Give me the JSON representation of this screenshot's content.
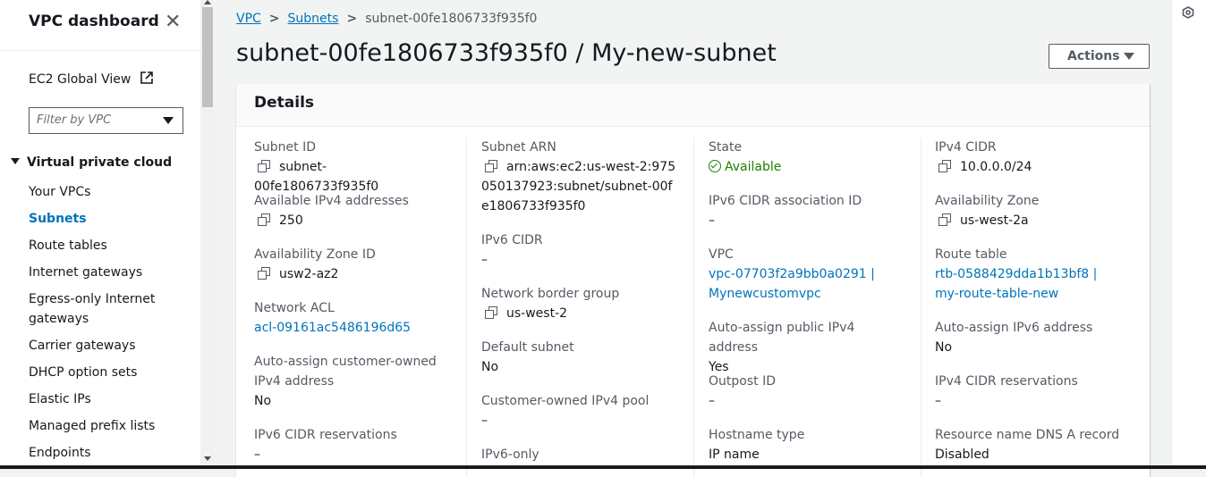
{
  "sidebar": {
    "title": "VPC dashboard",
    "global_view": "EC2 Global View",
    "filter_placeholder": "Filter by VPC",
    "section": "Virtual private cloud",
    "items": [
      {
        "label": "Your VPCs"
      },
      {
        "label": "Subnets"
      },
      {
        "label": "Route tables"
      },
      {
        "label": "Internet gateways"
      },
      {
        "label": "Egress-only Internet gateways"
      },
      {
        "label": "Carrier gateways"
      },
      {
        "label": "DHCP option sets"
      },
      {
        "label": "Elastic IPs"
      },
      {
        "label": "Managed prefix lists"
      },
      {
        "label": "Endpoints"
      }
    ]
  },
  "breadcrumb": {
    "vpc": "VPC",
    "subnets": "Subnets",
    "current": "subnet-00fe1806733f935f0"
  },
  "header": {
    "title": "subnet-00fe1806733f935f0 / My-new-subnet",
    "actions_label": "Actions"
  },
  "details": {
    "heading": "Details",
    "col1": {
      "subnet_id_label": "Subnet ID",
      "subnet_id": "subnet-00fe1806733f935f0",
      "avail_ipv4_label": "Available IPv4 addresses",
      "avail_ipv4": "250",
      "az_id_label": "Availability Zone ID",
      "az_id": "usw2-az2",
      "nacl_label": "Network ACL",
      "nacl": "acl-09161ac5486196d65",
      "auto_cust_label": "Auto-assign customer-owned IPv4 address",
      "auto_cust": "No",
      "ipv6_res_label": "IPv6 CIDR reservations",
      "ipv6_res": "–"
    },
    "col2": {
      "arn_label": "Subnet ARN",
      "arn": "arn:aws:ec2:us-west-2:975050137923:subnet/subnet-00fe1806733f935f0",
      "ipv6_cidr_label": "IPv6 CIDR",
      "ipv6_cidr": "–",
      "nbg_label": "Network border group",
      "nbg": "us-west-2",
      "default_label": "Default subnet",
      "default": "No",
      "cust_pool_label": "Customer-owned IPv4 pool",
      "cust_pool": "–",
      "ipv6_only_label": "IPv6-only"
    },
    "col3": {
      "state_label": "State",
      "state": "Available",
      "ipv6_assoc_label": "IPv6 CIDR association ID",
      "ipv6_assoc": "–",
      "vpc_label": "VPC",
      "vpc": "vpc-07703f2a9bb0a0291 | Mynewcustomvpc",
      "auto_pub_label": "Auto-assign public IPv4 address",
      "auto_pub": "Yes",
      "outpost_label": "Outpost ID",
      "outpost": "–",
      "hostname_label": "Hostname type",
      "hostname": "IP name"
    },
    "col4": {
      "ipv4_cidr_label": "IPv4 CIDR",
      "ipv4_cidr": "10.0.0.0/24",
      "az_label": "Availability Zone",
      "az": "us-west-2a",
      "rt_label": "Route table",
      "rt": "rtb-0588429dda1b13bf8 | my-route-table-new",
      "auto_ipv6_label": "Auto-assign IPv6 address",
      "auto_ipv6": "No",
      "ipv4_res_label": "IPv4 CIDR reservations",
      "ipv4_res": "–",
      "dns_a_label": "Resource name DNS A record",
      "dns_a": "Disabled"
    }
  },
  "colors": {
    "link": "#0073bb",
    "success": "#1d8102",
    "text": "#16191f",
    "muted": "#545b64"
  }
}
